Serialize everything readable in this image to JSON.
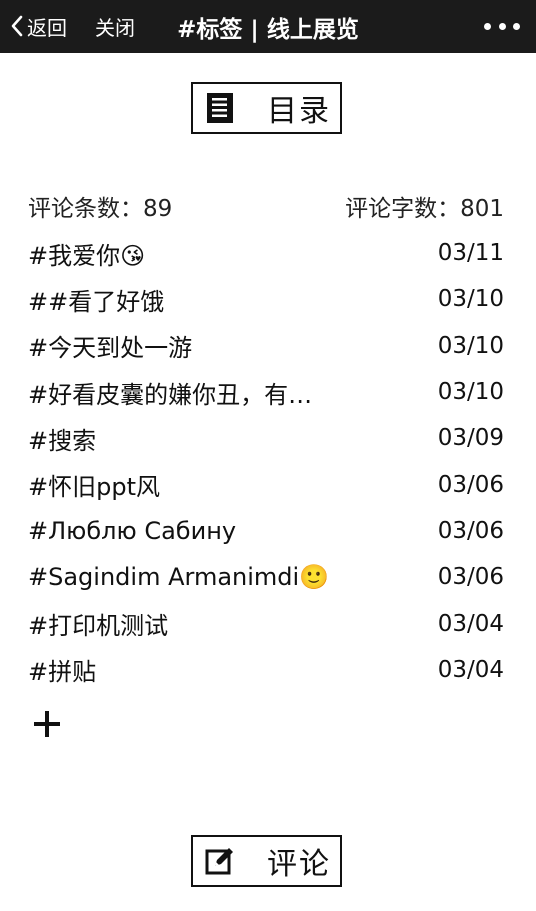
{
  "topbar": {
    "back_label": "返回",
    "close_label": "关闭",
    "title": "#标签 | 线上展览"
  },
  "toc_button": {
    "label": "目录",
    "icon": "document-list-icon"
  },
  "stats": {
    "comment_count_label": "评论条数：89",
    "char_count_label": "评论字数：801"
  },
  "entries": [
    {
      "title": "#我爱你😘",
      "date": "03/11"
    },
    {
      "title": "##看了好饿",
      "date": "03/10"
    },
    {
      "title": "#今天到处一游",
      "date": "03/10"
    },
    {
      "title": "#好看皮囊的嫌你丑，有…",
      "date": "03/10"
    },
    {
      "title": "#搜索",
      "date": "03/09"
    },
    {
      "title": "#怀旧ppt风",
      "date": "03/06"
    },
    {
      "title": "#Люблю Сабину",
      "date": "03/06"
    },
    {
      "title": "#Sagindim Armanimdi🙂",
      "date": "03/06"
    },
    {
      "title": "#打印机测试",
      "date": "03/04"
    },
    {
      "title": "#拼贴",
      "date": "03/04"
    }
  ],
  "add_icon": "plus-icon",
  "comment_button": {
    "label": "评论",
    "icon": "edit-icon"
  }
}
